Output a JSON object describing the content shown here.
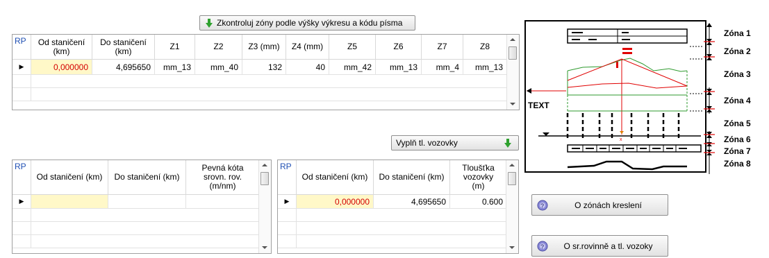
{
  "top_button": {
    "label": "Zkontroluj zóny  podle výšky výkresu a kódu písma"
  },
  "grid1": {
    "rp_label": "RP",
    "columns": [
      "Od staničení (km)",
      "Do staničení (km)",
      "Z1",
      "Z2",
      "Z3 (mm)",
      "Z4 (mm)",
      "Z5",
      "Z6",
      "Z7",
      "Z8"
    ],
    "rows": [
      {
        "marker": "▶",
        "cells": [
          "0,000000",
          "4,695650",
          "mm_13",
          "mm_40",
          "132",
          "40",
          "mm_42",
          "mm_13",
          "mm_4",
          "mm_13"
        ]
      }
    ]
  },
  "fill_button": {
    "label": "Vyplň tl. vozovky"
  },
  "grid2": {
    "rp_label": "RP",
    "columns": [
      "Od staničení (km)",
      "Do staničení (km)",
      "Pevná kóta srovn. rov. (m/nm)"
    ],
    "rows": [
      {
        "marker": "▶",
        "cells": [
          "",
          "",
          ""
        ]
      }
    ]
  },
  "grid3": {
    "rp_label": "RP",
    "columns": [
      "Od staničení (km)",
      "Do staničení (km)",
      "Tloušťka vozovky (m)"
    ],
    "rows": [
      {
        "marker": "▶",
        "cells": [
          "0,000000",
          "4,695650",
          "0.600"
        ]
      }
    ]
  },
  "diagram": {
    "zones": [
      "Zóna 1",
      "Zóna 2",
      "Zóna 3",
      "Zóna 4",
      "Zóna 5",
      "Zóna 6",
      "Zóna 7",
      "Zóna 8"
    ],
    "text_label": "TEXT"
  },
  "help_buttons": {
    "zones": "O zónách kreslení",
    "road": "O sr.rovinně a tl. vozoky"
  },
  "colors": {
    "accent_red": "#e00000",
    "accent_green": "#2e9a2e",
    "highlight_yellow": "#fff8c8",
    "header_blue": "#1f4fb3"
  }
}
